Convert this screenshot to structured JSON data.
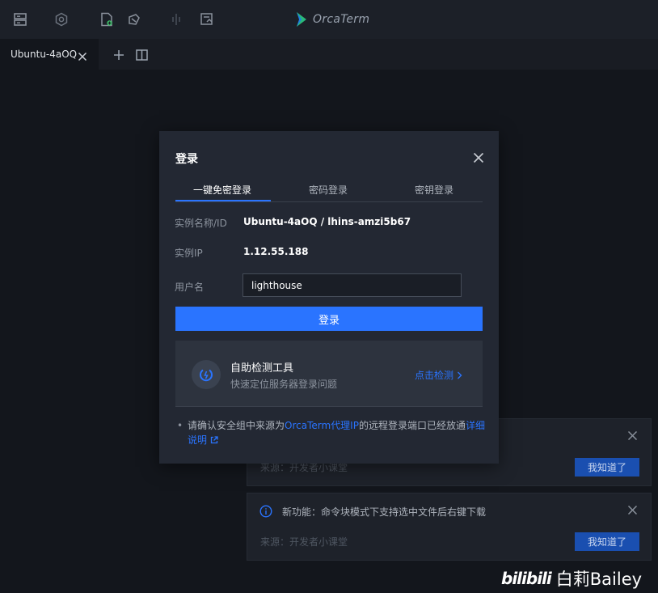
{
  "app": {
    "name": "OrcaTerm",
    "colors": {
      "accent": "#2a74ff",
      "background": "#13161c",
      "panel": "#232833"
    }
  },
  "toolbar": {
    "icons": [
      "server-list-icon",
      "settings-icon",
      "new-file-icon",
      "broadcast-icon",
      "split-icon",
      "history-icon"
    ]
  },
  "tabs": [
    {
      "label": "Ubuntu-4aOQ",
      "active": true
    }
  ],
  "modal": {
    "title": "登录",
    "tabs": [
      {
        "label": "一键免密登录",
        "active": true
      },
      {
        "label": "密码登录",
        "active": false
      },
      {
        "label": "密钥登录",
        "active": false
      }
    ],
    "instance_name_label": "实例名称/ID",
    "instance_name_value": "Ubuntu-4aOQ / lhins-amzi5b67",
    "instance_ip_label": "实例IP",
    "instance_ip_value": "1.12.55.188",
    "username_label": "用户名",
    "username_value": "lighthouse",
    "login_button": "登录",
    "tool": {
      "title": "自助检测工具",
      "desc": "快速定位服务器登录问题",
      "link": "点击检测"
    },
    "note": {
      "part1": "请确认安全组中来源为",
      "link1": "OrcaTerm代理IP",
      "part2": "的远程登录端口已经放通",
      "link2": "详细说明"
    }
  },
  "notices": [
    {
      "title": "",
      "source": "来源：开发者小课堂",
      "button": "我知道了"
    },
    {
      "title": "新功能：命令块模式下支持选中文件后右键下载",
      "source": "来源：开发者小课堂",
      "button": "我知道了"
    }
  ],
  "watermark": {
    "logo": "bilibili",
    "text": "白莉Bailey"
  }
}
